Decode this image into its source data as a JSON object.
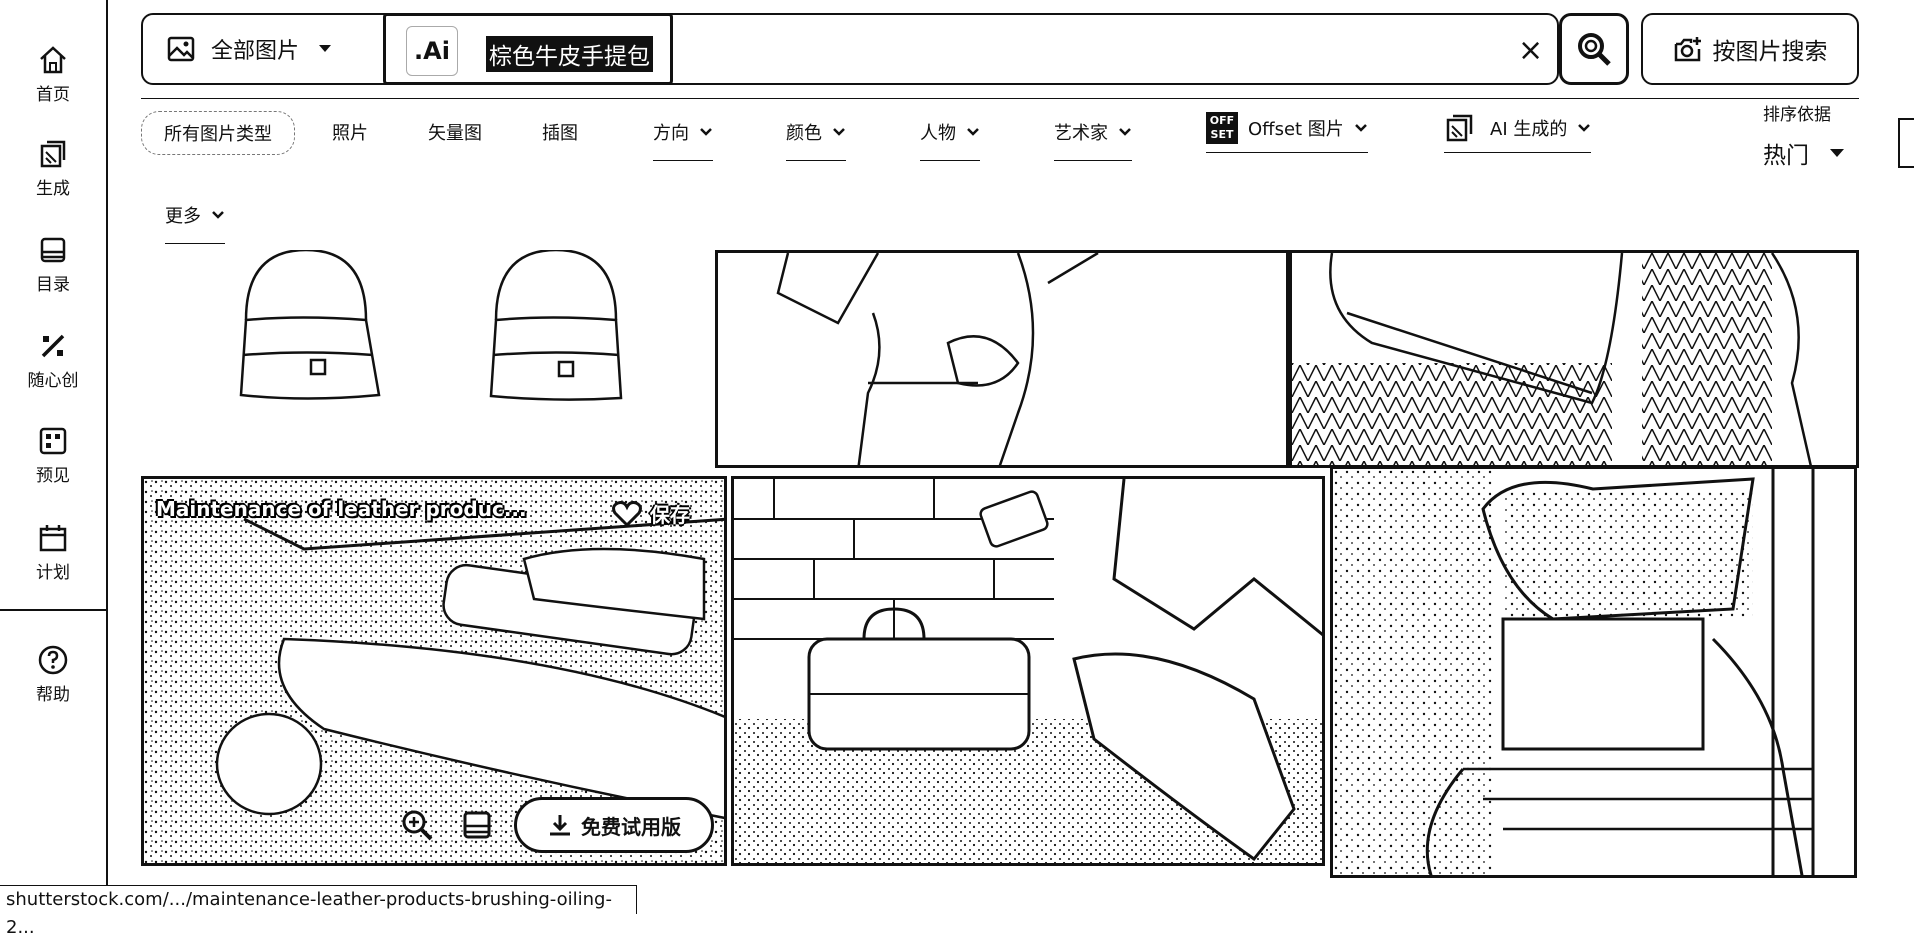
{
  "sidebar": {
    "items": [
      {
        "label": "首页",
        "icon": "home-icon"
      },
      {
        "label": "生成",
        "icon": "generate-icon"
      },
      {
        "label": "目录",
        "icon": "catalog-icon"
      },
      {
        "label": "随心创",
        "icon": "create-icon"
      },
      {
        "label": "预见",
        "icon": "predict-icon"
      },
      {
        "label": "计划",
        "icon": "calendar-icon"
      }
    ],
    "help": {
      "label": "帮助",
      "icon": "help-icon"
    }
  },
  "search": {
    "scope_label": "全部图片",
    "ai_logo": ".Ai",
    "query": "棕色牛皮手提包",
    "clear_symbol": "×",
    "image_search_label": "按图片搜索"
  },
  "filters": {
    "items": [
      "所有图片类型",
      "照片",
      "矢量图",
      "插图",
      "方向",
      "颜色",
      "人物",
      "艺术家",
      "Offset 图片",
      "AI 生成的",
      "更多"
    ],
    "offset_logo_top": "OFF",
    "offset_logo_bottom": "SET"
  },
  "sort": {
    "label": "排序依据",
    "value": "热门"
  },
  "cards": [
    {
      "title": "Maintenance of leather produc...",
      "save_label": "保存",
      "try_label": "免费试用版"
    }
  ],
  "status_url": "shutterstock.com/.../maintenance-leather-products-brushing-oiling-2..."
}
